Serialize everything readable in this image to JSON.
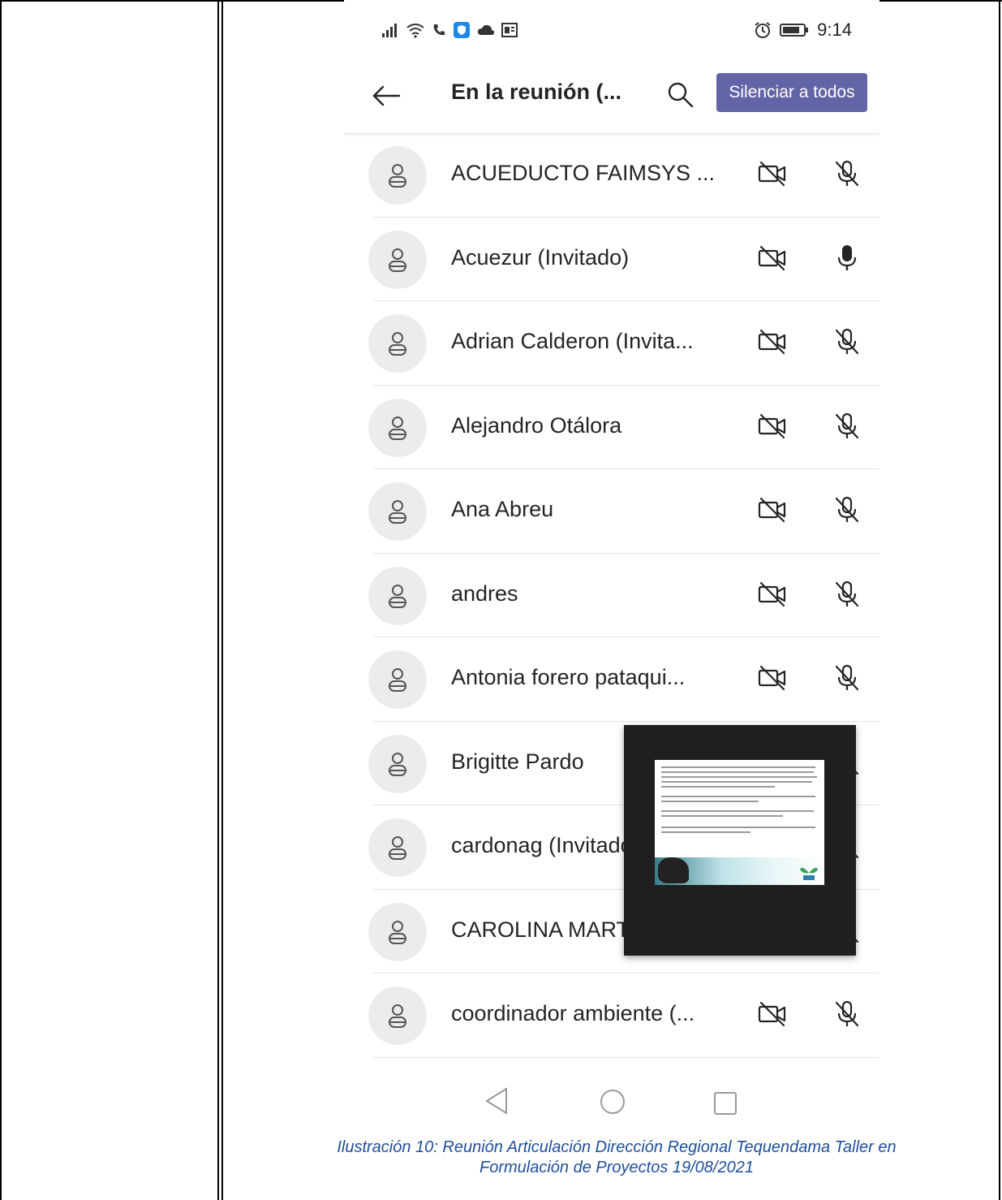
{
  "status_bar": {
    "time": "9:14",
    "left_icons": [
      "signal-icon",
      "wifi-icon",
      "call-icon",
      "shield-app-icon",
      "cloud-icon",
      "office-icon"
    ],
    "right_icons": [
      "alarm-icon",
      "battery-icon"
    ]
  },
  "header": {
    "title": "En la reunión (...",
    "mute_all_label": "Silenciar a todos"
  },
  "participants": [
    {
      "name": "ACUEDUCTO FAIMSYS ...",
      "camera": "off",
      "mic": "muted"
    },
    {
      "name": "Acuezur (Invitado)",
      "camera": "off",
      "mic": "on"
    },
    {
      "name": "Adrian Calderon (Invita...",
      "camera": "off",
      "mic": "muted"
    },
    {
      "name": "Alejandro Otálora",
      "camera": "off",
      "mic": "muted"
    },
    {
      "name": "Ana Abreu",
      "camera": "off",
      "mic": "muted"
    },
    {
      "name": "andres",
      "camera": "off",
      "mic": "muted"
    },
    {
      "name": "Antonia forero pataqui...",
      "camera": "off",
      "mic": "muted"
    },
    {
      "name": "Brigitte Pardo",
      "camera": "off",
      "mic": "muted"
    },
    {
      "name": "cardonag (Invitado)",
      "camera": "off",
      "mic": "muted"
    },
    {
      "name": "CAROLINA MARTINEZ",
      "camera": "off",
      "mic": "muted"
    },
    {
      "name": "coordinador ambiente (...",
      "camera": "off",
      "mic": "muted"
    }
  ],
  "caption": {
    "line1": "Ilustración 10: Reunión Articulación Dirección Regional Tequendama Taller en",
    "line2": "Formulación de Proyectos 19/08/2021"
  },
  "colors": {
    "accent": "#6264a7",
    "caption": "#1f4e9a"
  }
}
